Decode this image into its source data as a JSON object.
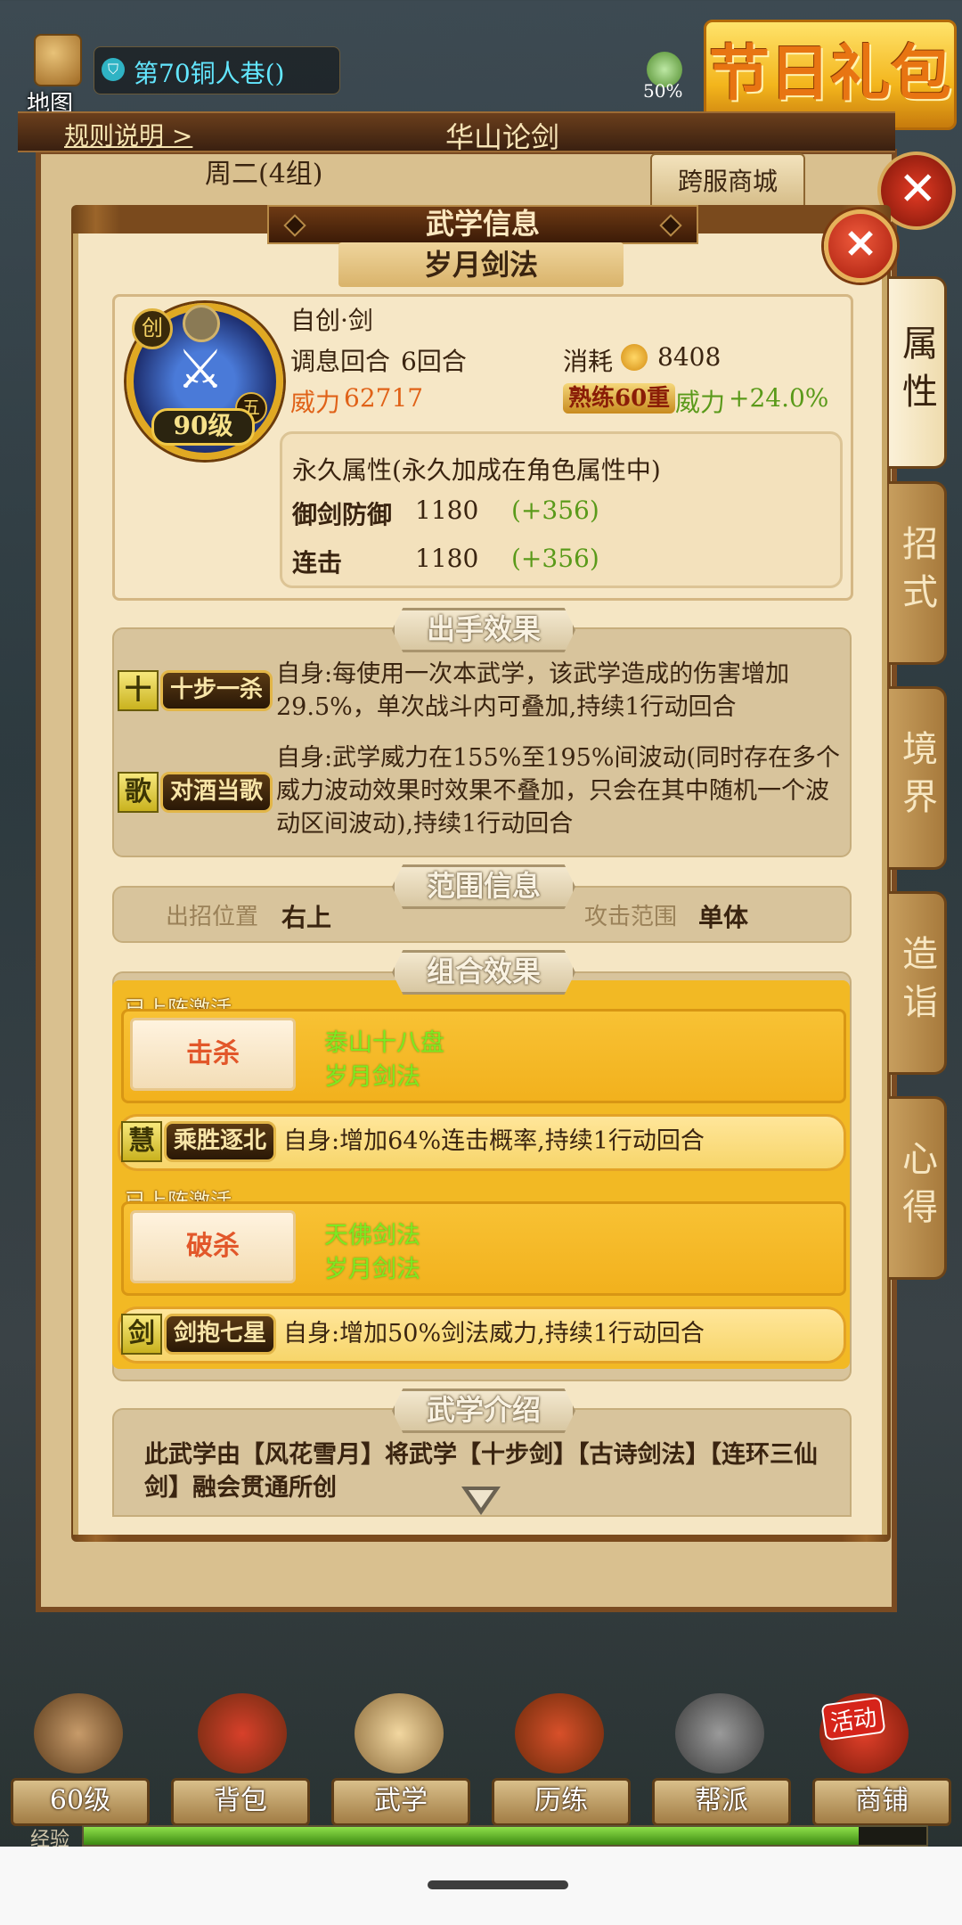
{
  "hud": {
    "map_label": "地图",
    "location": "第70铜人巷()",
    "percent": "50%",
    "gift_label": "节日礼包"
  },
  "underlying": {
    "rules_link": "规则说明 >",
    "title": "华山论剑",
    "day": "周二(4组)",
    "cross_server_shop": "跨服商城"
  },
  "modal": {
    "title": "武学信息",
    "skill_name": "岁月剑法",
    "close": "✕",
    "tabs": [
      "属性",
      "招式",
      "境界",
      "造诣",
      "心得"
    ],
    "avatar": {
      "badge": "创",
      "grade": "五",
      "level": "90级"
    },
    "info": {
      "category": "自创·剑",
      "rest_rounds_label": "调息回合",
      "rest_rounds_value": "6回合",
      "cost_label": "消耗",
      "cost_value": "8408",
      "power_label": "威力",
      "power_value": "62717",
      "proficiency": "熟练60重",
      "power_bonus_label": "威力",
      "power_bonus_value": "+24.0%"
    },
    "permanent": {
      "title": "永久属性(永久加成在角色属性中)",
      "rows": [
        {
          "name": "御剑防御",
          "value": "1180",
          "bonus": "(+356)"
        },
        {
          "name": "连击",
          "value": "1180",
          "bonus": "(+356)"
        }
      ]
    },
    "effects_header": "出手效果",
    "effects": [
      {
        "icon": "十",
        "tag": "十步一杀",
        "text": "自身:每使用一次本武学，该武学造成的伤害增加29.5%，单次战斗内可叠加,持续1行动回合"
      },
      {
        "icon": "歌",
        "tag": "对酒当歌",
        "text": "自身:武学威力在155%至195%间波动(同时存在多个威力波动效果时效果不叠加，只会在其中随机一个波动区间波动),持续1行动回合"
      }
    ],
    "range_header": "范围信息",
    "range": {
      "position_label": "出招位置",
      "position_value": "右上",
      "target_label": "攻击范围",
      "target_value": "单体"
    },
    "combo_header": "组合效果",
    "combos": [
      {
        "status": "已上阵激活",
        "card": "击杀",
        "skills": [
          "泰山十八盘",
          "岁月剑法"
        ],
        "icon": "慧",
        "tag": "乘胜逐北",
        "effect": "自身:增加64%连击概率,持续1行动回合"
      },
      {
        "status": "已上阵激活",
        "card": "破杀",
        "skills": [
          "天佛剑法",
          "岁月剑法"
        ],
        "icon": "剑",
        "tag": "剑抱七星",
        "effect": "自身:增加50%剑法威力,持续1行动回合"
      }
    ],
    "intro_header": "武学介绍",
    "intro_text": "此武学由【风花雪月】将武学【十步剑】【古诗剑法】【连环三仙剑】融会贯通所创"
  },
  "bottom_nav": {
    "items": [
      "60级",
      "背包",
      "武学",
      "历练",
      "帮派",
      "商铺"
    ],
    "activity_badge": "活动",
    "xp_label": "经验",
    "xp_fraction": 0.92
  }
}
